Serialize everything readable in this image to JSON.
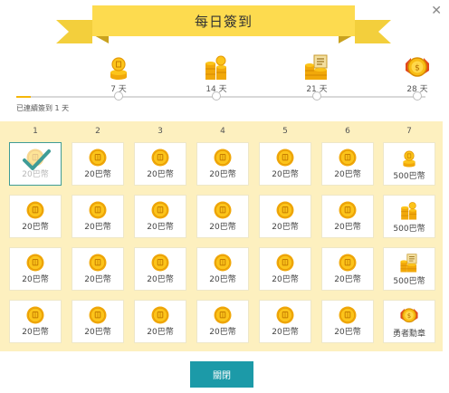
{
  "header": {
    "title": "每日簽到"
  },
  "close_icon": "✕",
  "milestones": [
    {
      "label": "7 天",
      "icon": "single-coin-icon"
    },
    {
      "label": "14 天",
      "icon": "coin-stack-icon"
    },
    {
      "label": "21 天",
      "icon": "coin-pile-icon"
    },
    {
      "label": "28 天",
      "icon": "medal-icon"
    }
  ],
  "progress_text": "已連續簽到 1 天",
  "progress_fraction": 0.036,
  "day_headers": [
    "1",
    "2",
    "3",
    "4",
    "5",
    "6",
    "7"
  ],
  "rows": [
    [
      {
        "label": "20巴幣",
        "icon": "coin-icon",
        "checked": true
      },
      {
        "label": "20巴幣",
        "icon": "coin-icon"
      },
      {
        "label": "20巴幣",
        "icon": "coin-icon"
      },
      {
        "label": "20巴幣",
        "icon": "coin-icon"
      },
      {
        "label": "20巴幣",
        "icon": "coin-icon"
      },
      {
        "label": "20巴幣",
        "icon": "coin-icon"
      },
      {
        "label": "500巴幣",
        "icon": "single-coin-icon"
      }
    ],
    [
      {
        "label": "20巴幣",
        "icon": "coin-icon"
      },
      {
        "label": "20巴幣",
        "icon": "coin-icon"
      },
      {
        "label": "20巴幣",
        "icon": "coin-icon"
      },
      {
        "label": "20巴幣",
        "icon": "coin-icon"
      },
      {
        "label": "20巴幣",
        "icon": "coin-icon"
      },
      {
        "label": "20巴幣",
        "icon": "coin-icon"
      },
      {
        "label": "500巴幣",
        "icon": "coin-stack-icon"
      }
    ],
    [
      {
        "label": "20巴幣",
        "icon": "coin-icon"
      },
      {
        "label": "20巴幣",
        "icon": "coin-icon"
      },
      {
        "label": "20巴幣",
        "icon": "coin-icon"
      },
      {
        "label": "20巴幣",
        "icon": "coin-icon"
      },
      {
        "label": "20巴幣",
        "icon": "coin-icon"
      },
      {
        "label": "20巴幣",
        "icon": "coin-icon"
      },
      {
        "label": "500巴幣",
        "icon": "coin-pile-icon"
      }
    ],
    [
      {
        "label": "20巴幣",
        "icon": "coin-icon"
      },
      {
        "label": "20巴幣",
        "icon": "coin-icon"
      },
      {
        "label": "20巴幣",
        "icon": "coin-icon"
      },
      {
        "label": "20巴幣",
        "icon": "coin-icon"
      },
      {
        "label": "20巴幣",
        "icon": "coin-icon"
      },
      {
        "label": "20巴幣",
        "icon": "coin-icon"
      },
      {
        "label": "勇者勳章",
        "icon": "medal-icon"
      }
    ]
  ],
  "footer": {
    "close_label": "關閉"
  },
  "colors": {
    "accent": "#1c9aa8",
    "ribbon": "#fddb4f",
    "grid_bg": "#fdf0bf",
    "coin": "#f5b70a",
    "progress": "#f5b70a"
  }
}
